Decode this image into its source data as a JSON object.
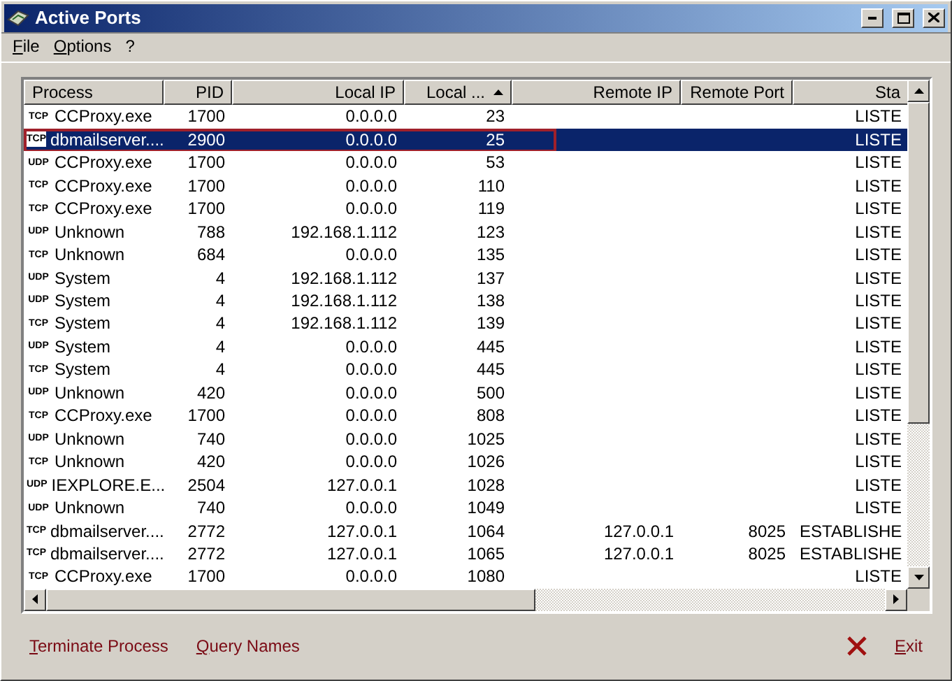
{
  "window": {
    "title": "Active Ports"
  },
  "menu": [
    "File",
    "Options",
    "?"
  ],
  "table": {
    "columns": [
      {
        "label": "Process",
        "sorted": false
      },
      {
        "label": "PID",
        "sorted": false
      },
      {
        "label": "Local IP",
        "sorted": false
      },
      {
        "label": "Local ...",
        "sorted": true
      },
      {
        "label": "Remote IP",
        "sorted": false
      },
      {
        "label": "Remote Port",
        "sorted": false
      },
      {
        "label": "Sta",
        "sorted": false
      }
    ],
    "rows": [
      {
        "proto": "TCP",
        "process": "CCProxy.exe",
        "pid": "1700",
        "local_ip": "0.0.0.0",
        "local_port": "23",
        "remote_ip": "",
        "remote_port": "",
        "state": "LISTE",
        "selected": false,
        "outlined": false
      },
      {
        "proto": "TCP",
        "process": "dbmailserver....",
        "pid": "2900",
        "local_ip": "0.0.0.0",
        "local_port": "25",
        "remote_ip": "",
        "remote_port": "",
        "state": "LISTE",
        "selected": true,
        "outlined": true
      },
      {
        "proto": "UDP",
        "process": "CCProxy.exe",
        "pid": "1700",
        "local_ip": "0.0.0.0",
        "local_port": "53",
        "remote_ip": "",
        "remote_port": "",
        "state": "LISTE",
        "selected": false,
        "outlined": false
      },
      {
        "proto": "TCP",
        "process": "CCProxy.exe",
        "pid": "1700",
        "local_ip": "0.0.0.0",
        "local_port": "110",
        "remote_ip": "",
        "remote_port": "",
        "state": "LISTE",
        "selected": false,
        "outlined": false
      },
      {
        "proto": "TCP",
        "process": "CCProxy.exe",
        "pid": "1700",
        "local_ip": "0.0.0.0",
        "local_port": "119",
        "remote_ip": "",
        "remote_port": "",
        "state": "LISTE",
        "selected": false,
        "outlined": false
      },
      {
        "proto": "UDP",
        "process": "Unknown",
        "pid": "788",
        "local_ip": "192.168.1.112",
        "local_port": "123",
        "remote_ip": "",
        "remote_port": "",
        "state": "LISTE",
        "selected": false,
        "outlined": false
      },
      {
        "proto": "TCP",
        "process": "Unknown",
        "pid": "684",
        "local_ip": "0.0.0.0",
        "local_port": "135",
        "remote_ip": "",
        "remote_port": "",
        "state": "LISTE",
        "selected": false,
        "outlined": false
      },
      {
        "proto": "UDP",
        "process": "System",
        "pid": "4",
        "local_ip": "192.168.1.112",
        "local_port": "137",
        "remote_ip": "",
        "remote_port": "",
        "state": "LISTE",
        "selected": false,
        "outlined": false
      },
      {
        "proto": "UDP",
        "process": "System",
        "pid": "4",
        "local_ip": "192.168.1.112",
        "local_port": "138",
        "remote_ip": "",
        "remote_port": "",
        "state": "LISTE",
        "selected": false,
        "outlined": false
      },
      {
        "proto": "TCP",
        "process": "System",
        "pid": "4",
        "local_ip": "192.168.1.112",
        "local_port": "139",
        "remote_ip": "",
        "remote_port": "",
        "state": "LISTE",
        "selected": false,
        "outlined": false
      },
      {
        "proto": "UDP",
        "process": "System",
        "pid": "4",
        "local_ip": "0.0.0.0",
        "local_port": "445",
        "remote_ip": "",
        "remote_port": "",
        "state": "LISTE",
        "selected": false,
        "outlined": false
      },
      {
        "proto": "TCP",
        "process": "System",
        "pid": "4",
        "local_ip": "0.0.0.0",
        "local_port": "445",
        "remote_ip": "",
        "remote_port": "",
        "state": "LISTE",
        "selected": false,
        "outlined": false
      },
      {
        "proto": "UDP",
        "process": "Unknown",
        "pid": "420",
        "local_ip": "0.0.0.0",
        "local_port": "500",
        "remote_ip": "",
        "remote_port": "",
        "state": "LISTE",
        "selected": false,
        "outlined": false
      },
      {
        "proto": "TCP",
        "process": "CCProxy.exe",
        "pid": "1700",
        "local_ip": "0.0.0.0",
        "local_port": "808",
        "remote_ip": "",
        "remote_port": "",
        "state": "LISTE",
        "selected": false,
        "outlined": false
      },
      {
        "proto": "UDP",
        "process": "Unknown",
        "pid": "740",
        "local_ip": "0.0.0.0",
        "local_port": "1025",
        "remote_ip": "",
        "remote_port": "",
        "state": "LISTE",
        "selected": false,
        "outlined": false
      },
      {
        "proto": "TCP",
        "process": "Unknown",
        "pid": "420",
        "local_ip": "0.0.0.0",
        "local_port": "1026",
        "remote_ip": "",
        "remote_port": "",
        "state": "LISTE",
        "selected": false,
        "outlined": false
      },
      {
        "proto": "UDP",
        "process": "IEXPLORE.E...",
        "pid": "2504",
        "local_ip": "127.0.0.1",
        "local_port": "1028",
        "remote_ip": "",
        "remote_port": "",
        "state": "LISTE",
        "selected": false,
        "outlined": false
      },
      {
        "proto": "UDP",
        "process": "Unknown",
        "pid": "740",
        "local_ip": "0.0.0.0",
        "local_port": "1049",
        "remote_ip": "",
        "remote_port": "",
        "state": "LISTE",
        "selected": false,
        "outlined": false
      },
      {
        "proto": "TCP",
        "process": "dbmailserver....",
        "pid": "2772",
        "local_ip": "127.0.0.1",
        "local_port": "1064",
        "remote_ip": "127.0.0.1",
        "remote_port": "8025",
        "state": "ESTABLISHE",
        "selected": false,
        "outlined": false
      },
      {
        "proto": "TCP",
        "process": "dbmailserver....",
        "pid": "2772",
        "local_ip": "127.0.0.1",
        "local_port": "1065",
        "remote_ip": "127.0.0.1",
        "remote_port": "8025",
        "state": "ESTABLISHE",
        "selected": false,
        "outlined": false
      },
      {
        "proto": "TCP",
        "process": "CCProxy.exe",
        "pid": "1700",
        "local_ip": "0.0.0.0",
        "local_port": "1080",
        "remote_ip": "",
        "remote_port": "",
        "state": "LISTE",
        "selected": false,
        "outlined": false
      }
    ]
  },
  "actions": [
    "Terminate Process",
    "Query Names"
  ],
  "exit": "Exit"
}
